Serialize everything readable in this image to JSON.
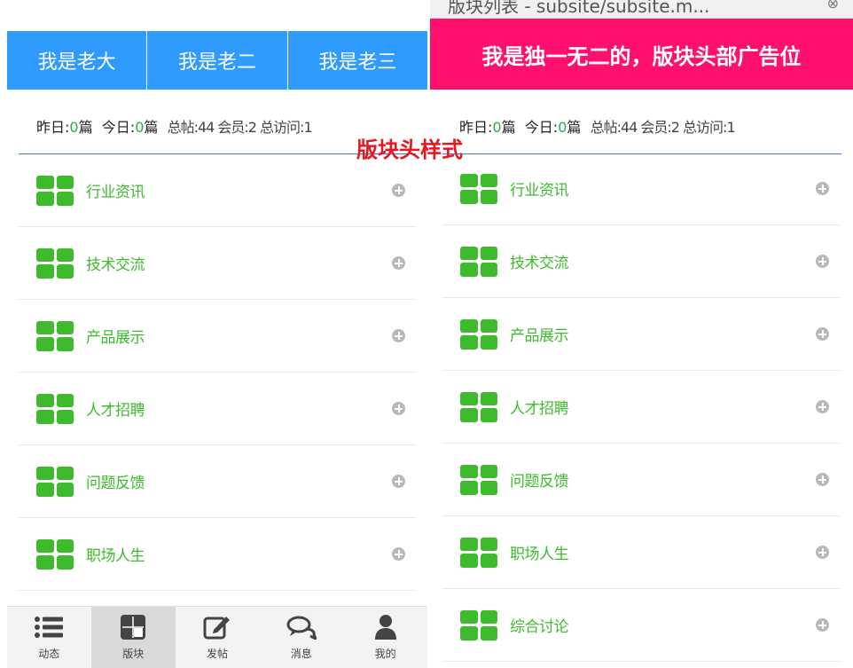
{
  "left": {
    "tabs": [
      "我是老大",
      "我是老二",
      "我是老三"
    ],
    "stats": {
      "yesterday_label": "昨日:",
      "yesterday_value": "0",
      "yesterday_unit": "篇",
      "today_label": "今日:",
      "today_value": "0",
      "today_unit": "篇",
      "garbled": "总帖:44 会员:2 总访问:1"
    },
    "forums": [
      {
        "name": "行业资讯"
      },
      {
        "name": "技术交流"
      },
      {
        "name": "产品展示"
      },
      {
        "name": "人才招聘"
      },
      {
        "name": "问题反馈"
      },
      {
        "name": "职场人生"
      }
    ],
    "nav": [
      {
        "label": "动态",
        "icon": "list-icon"
      },
      {
        "label": "版块",
        "icon": "grid-board-icon"
      },
      {
        "label": "发帖",
        "icon": "edit-icon"
      },
      {
        "label": "消息",
        "icon": "chat-icon"
      },
      {
        "label": "我的",
        "icon": "user-icon"
      }
    ],
    "active_nav": "版块"
  },
  "right": {
    "browser_text": "版块列表 - subsite/subsite.m...",
    "ad_banner": "我是独一无二的，版块头部广告位",
    "stats": {
      "yesterday_label": "昨日:",
      "yesterday_value": "0",
      "yesterday_unit": "篇",
      "today_label": "今日:",
      "today_value": "0",
      "today_unit": "篇",
      "garbled": "总帖:44 会员:2 总访问:1"
    },
    "forums": [
      {
        "name": "行业资讯"
      },
      {
        "name": "技术交流"
      },
      {
        "name": "产品展示"
      },
      {
        "name": "人才招聘"
      },
      {
        "name": "问题反馈"
      },
      {
        "name": "职场人生"
      },
      {
        "name": "综合讨论"
      }
    ]
  },
  "annotation": "版块头样式",
  "colors": {
    "tab_blue": "#2f9bff",
    "ad_pink": "#ff0f6e",
    "accent_green": "#3dbb2c",
    "annotation_red": "#e8161f",
    "divider_blue": "#3a78d6"
  }
}
